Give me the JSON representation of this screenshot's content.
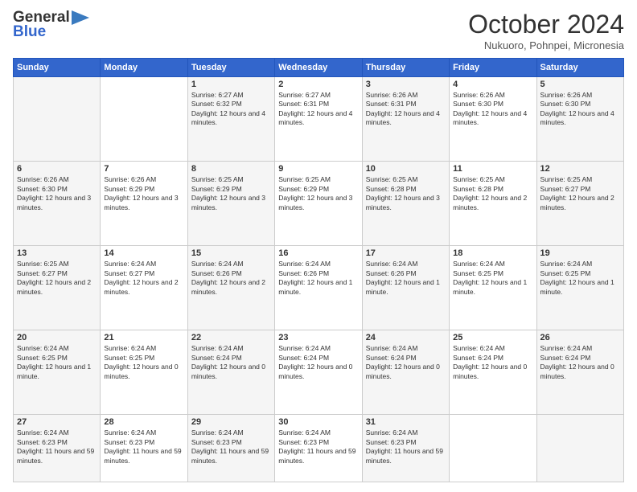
{
  "header": {
    "logo_line1": "General",
    "logo_line2": "Blue",
    "month": "October 2024",
    "location": "Nukuoro, Pohnpei, Micronesia"
  },
  "weekdays": [
    "Sunday",
    "Monday",
    "Tuesday",
    "Wednesday",
    "Thursday",
    "Friday",
    "Saturday"
  ],
  "weeks": [
    [
      {
        "day": "",
        "info": ""
      },
      {
        "day": "",
        "info": ""
      },
      {
        "day": "1",
        "info": "Sunrise: 6:27 AM\nSunset: 6:32 PM\nDaylight: 12 hours and 4 minutes."
      },
      {
        "day": "2",
        "info": "Sunrise: 6:27 AM\nSunset: 6:31 PM\nDaylight: 12 hours and 4 minutes."
      },
      {
        "day": "3",
        "info": "Sunrise: 6:26 AM\nSunset: 6:31 PM\nDaylight: 12 hours and 4 minutes."
      },
      {
        "day": "4",
        "info": "Sunrise: 6:26 AM\nSunset: 6:30 PM\nDaylight: 12 hours and 4 minutes."
      },
      {
        "day": "5",
        "info": "Sunrise: 6:26 AM\nSunset: 6:30 PM\nDaylight: 12 hours and 4 minutes."
      }
    ],
    [
      {
        "day": "6",
        "info": "Sunrise: 6:26 AM\nSunset: 6:30 PM\nDaylight: 12 hours and 3 minutes."
      },
      {
        "day": "7",
        "info": "Sunrise: 6:26 AM\nSunset: 6:29 PM\nDaylight: 12 hours and 3 minutes."
      },
      {
        "day": "8",
        "info": "Sunrise: 6:25 AM\nSunset: 6:29 PM\nDaylight: 12 hours and 3 minutes."
      },
      {
        "day": "9",
        "info": "Sunrise: 6:25 AM\nSunset: 6:29 PM\nDaylight: 12 hours and 3 minutes."
      },
      {
        "day": "10",
        "info": "Sunrise: 6:25 AM\nSunset: 6:28 PM\nDaylight: 12 hours and 3 minutes."
      },
      {
        "day": "11",
        "info": "Sunrise: 6:25 AM\nSunset: 6:28 PM\nDaylight: 12 hours and 2 minutes."
      },
      {
        "day": "12",
        "info": "Sunrise: 6:25 AM\nSunset: 6:27 PM\nDaylight: 12 hours and 2 minutes."
      }
    ],
    [
      {
        "day": "13",
        "info": "Sunrise: 6:25 AM\nSunset: 6:27 PM\nDaylight: 12 hours and 2 minutes."
      },
      {
        "day": "14",
        "info": "Sunrise: 6:24 AM\nSunset: 6:27 PM\nDaylight: 12 hours and 2 minutes."
      },
      {
        "day": "15",
        "info": "Sunrise: 6:24 AM\nSunset: 6:26 PM\nDaylight: 12 hours and 2 minutes."
      },
      {
        "day": "16",
        "info": "Sunrise: 6:24 AM\nSunset: 6:26 PM\nDaylight: 12 hours and 1 minute."
      },
      {
        "day": "17",
        "info": "Sunrise: 6:24 AM\nSunset: 6:26 PM\nDaylight: 12 hours and 1 minute."
      },
      {
        "day": "18",
        "info": "Sunrise: 6:24 AM\nSunset: 6:25 PM\nDaylight: 12 hours and 1 minute."
      },
      {
        "day": "19",
        "info": "Sunrise: 6:24 AM\nSunset: 6:25 PM\nDaylight: 12 hours and 1 minute."
      }
    ],
    [
      {
        "day": "20",
        "info": "Sunrise: 6:24 AM\nSunset: 6:25 PM\nDaylight: 12 hours and 1 minute."
      },
      {
        "day": "21",
        "info": "Sunrise: 6:24 AM\nSunset: 6:25 PM\nDaylight: 12 hours and 0 minutes."
      },
      {
        "day": "22",
        "info": "Sunrise: 6:24 AM\nSunset: 6:24 PM\nDaylight: 12 hours and 0 minutes."
      },
      {
        "day": "23",
        "info": "Sunrise: 6:24 AM\nSunset: 6:24 PM\nDaylight: 12 hours and 0 minutes."
      },
      {
        "day": "24",
        "info": "Sunrise: 6:24 AM\nSunset: 6:24 PM\nDaylight: 12 hours and 0 minutes."
      },
      {
        "day": "25",
        "info": "Sunrise: 6:24 AM\nSunset: 6:24 PM\nDaylight: 12 hours and 0 minutes."
      },
      {
        "day": "26",
        "info": "Sunrise: 6:24 AM\nSunset: 6:24 PM\nDaylight: 12 hours and 0 minutes."
      }
    ],
    [
      {
        "day": "27",
        "info": "Sunrise: 6:24 AM\nSunset: 6:23 PM\nDaylight: 11 hours and 59 minutes."
      },
      {
        "day": "28",
        "info": "Sunrise: 6:24 AM\nSunset: 6:23 PM\nDaylight: 11 hours and 59 minutes."
      },
      {
        "day": "29",
        "info": "Sunrise: 6:24 AM\nSunset: 6:23 PM\nDaylight: 11 hours and 59 minutes."
      },
      {
        "day": "30",
        "info": "Sunrise: 6:24 AM\nSunset: 6:23 PM\nDaylight: 11 hours and 59 minutes."
      },
      {
        "day": "31",
        "info": "Sunrise: 6:24 AM\nSunset: 6:23 PM\nDaylight: 11 hours and 59 minutes."
      },
      {
        "day": "",
        "info": ""
      },
      {
        "day": "",
        "info": ""
      }
    ]
  ]
}
